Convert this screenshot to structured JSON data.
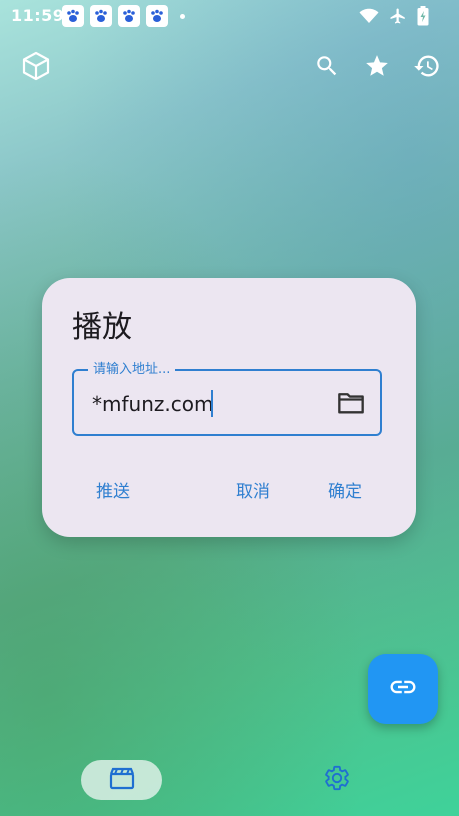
{
  "status_bar": {
    "time": "11:59",
    "notification_icons": [
      "paw-notification-icon",
      "paw-notification-icon",
      "paw-notification-icon",
      "paw-notification-icon"
    ],
    "right_icons": [
      "wifi-icon",
      "airplane-icon",
      "battery-charging-icon"
    ]
  },
  "toolbar": {
    "logo_icon": "cube-icon",
    "actions": [
      "search-icon",
      "star-icon",
      "history-icon"
    ]
  },
  "dialog": {
    "title": "播放",
    "address_field": {
      "label": "请输入地址...",
      "value": "*mfunz.com",
      "trailing_icon": "folder-icon"
    },
    "buttons": {
      "push": "推送",
      "cancel": "取消",
      "confirm": "确定"
    }
  },
  "fab": {
    "icon": "link-icon"
  },
  "bottom_nav": {
    "items": [
      "movie-icon",
      "gear-icon"
    ],
    "selected": "movie-icon"
  },
  "colors": {
    "accent": "#2f7fd0",
    "fab": "#2196f3",
    "dialog_bg": "#ece6f1"
  }
}
